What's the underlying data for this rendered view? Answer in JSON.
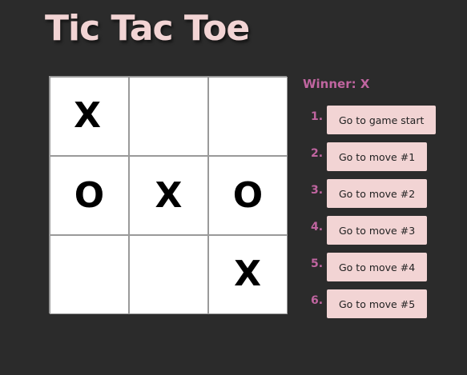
{
  "title": "Tic Tac Toe",
  "status": "Winner: X",
  "board": [
    "X",
    "",
    "",
    "O",
    "X",
    "O",
    "",
    "",
    "X"
  ],
  "moves": [
    {
      "num": "1.",
      "label": "Go to game start"
    },
    {
      "num": "2.",
      "label": "Go to move #1"
    },
    {
      "num": "3.",
      "label": "Go to move #2"
    },
    {
      "num": "4.",
      "label": "Go to move #3"
    },
    {
      "num": "5.",
      "label": "Go to move #4"
    },
    {
      "num": "6.",
      "label": "Go to move #5"
    }
  ]
}
